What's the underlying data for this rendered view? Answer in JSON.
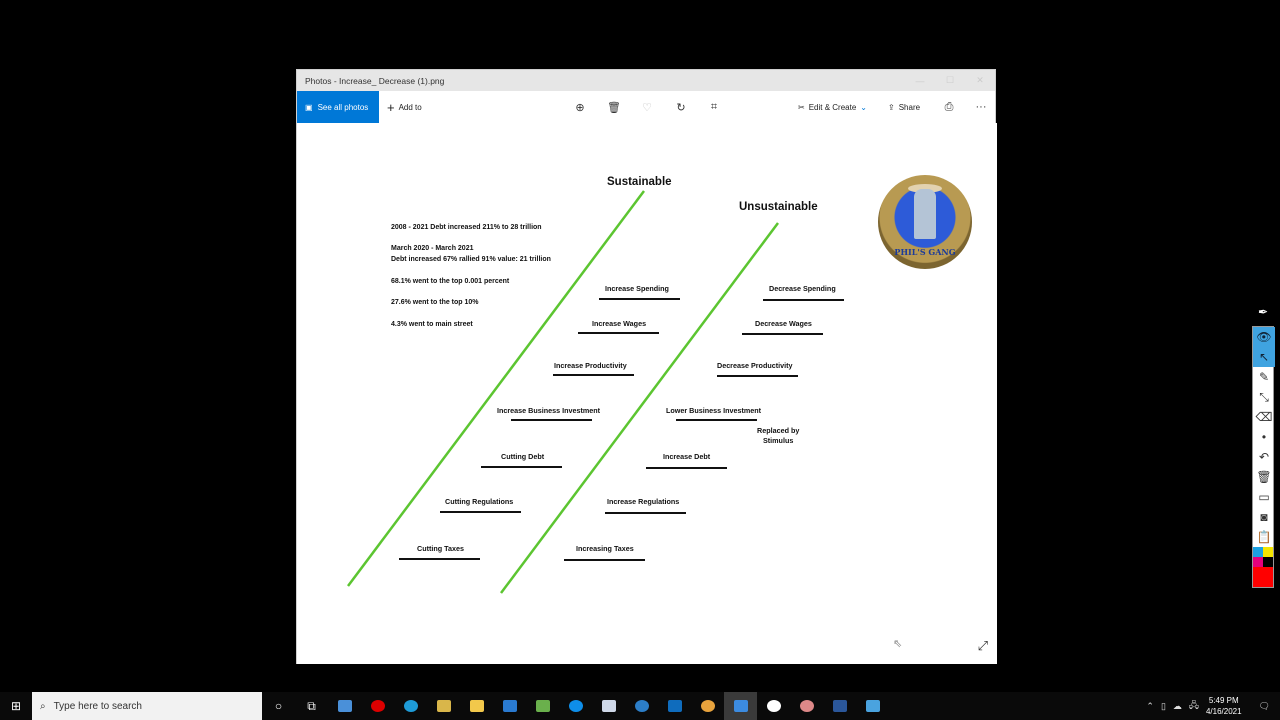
{
  "window": {
    "title": "Photos - Increase_ Decrease (1).png",
    "controls": [
      "minimize",
      "maximize",
      "close"
    ]
  },
  "toolbar": {
    "see_all_photos": "See all photos",
    "add_to": "Add to",
    "icons": [
      "zoom-icon",
      "delete-icon",
      "favorite-icon",
      "rotate-icon",
      "crop-icon"
    ],
    "edit_create": "Edit & Create",
    "share": "Share",
    "print_icon": "print-icon",
    "more": "···"
  },
  "image": {
    "heading_left": "Sustainable",
    "heading_right": "Unsustainable",
    "info_lines": [
      "2008 - 2021 Debt increased 211% to 28 trillion",
      "March 2020 - March 2021",
      "Debt increased 67% rallied 91% value: 21 trillion",
      "68.1% went to the top 0.001 percent",
      "27.6% went to the top 10%",
      "4.3% went to main street"
    ],
    "sustainable_items": [
      "Increase Spending",
      "Increase Wages",
      "Increase Productivity",
      "Increase Business Investment",
      "Cutting Debt",
      "Cutting Regulations",
      "Cutting Taxes"
    ],
    "unsustainable_items": [
      "Decrease Spending",
      "Decrease Wages",
      "Decrease Productivity",
      "Lower Business Investment",
      "Increase Debt",
      "Increase Regulations",
      "Increasing Taxes"
    ],
    "note": "Replaced by\nStimulus",
    "logo_text": "PHIL'S GANG",
    "line_color": "#5cc531"
  },
  "pen_toolbar": {
    "tools": [
      "pen-icon",
      "eye-icon",
      "pointer-icon",
      "highlighter-icon",
      "line-icon",
      "eraser-icon",
      "dot-icon",
      "undo-icon",
      "trash-icon",
      "whiteboard-icon",
      "camera-icon",
      "clipboard-icon"
    ],
    "colors": [
      "#1ba1e2",
      "#f4e600",
      "#e4007c",
      "#000000",
      "#ff0000"
    ]
  },
  "taskbar": {
    "search_placeholder": "Type here to search",
    "time": "5:49 PM",
    "date": "4/16/2021",
    "apps": [
      "cortana",
      "task-view",
      "remote-desktop",
      "opera",
      "edge",
      "vnote",
      "file-explorer",
      "vs-code",
      "sheets",
      "teamviewer",
      "window",
      "arc",
      "outlook",
      "slack",
      "photos",
      "marker",
      "paint",
      "word",
      "network"
    ]
  }
}
